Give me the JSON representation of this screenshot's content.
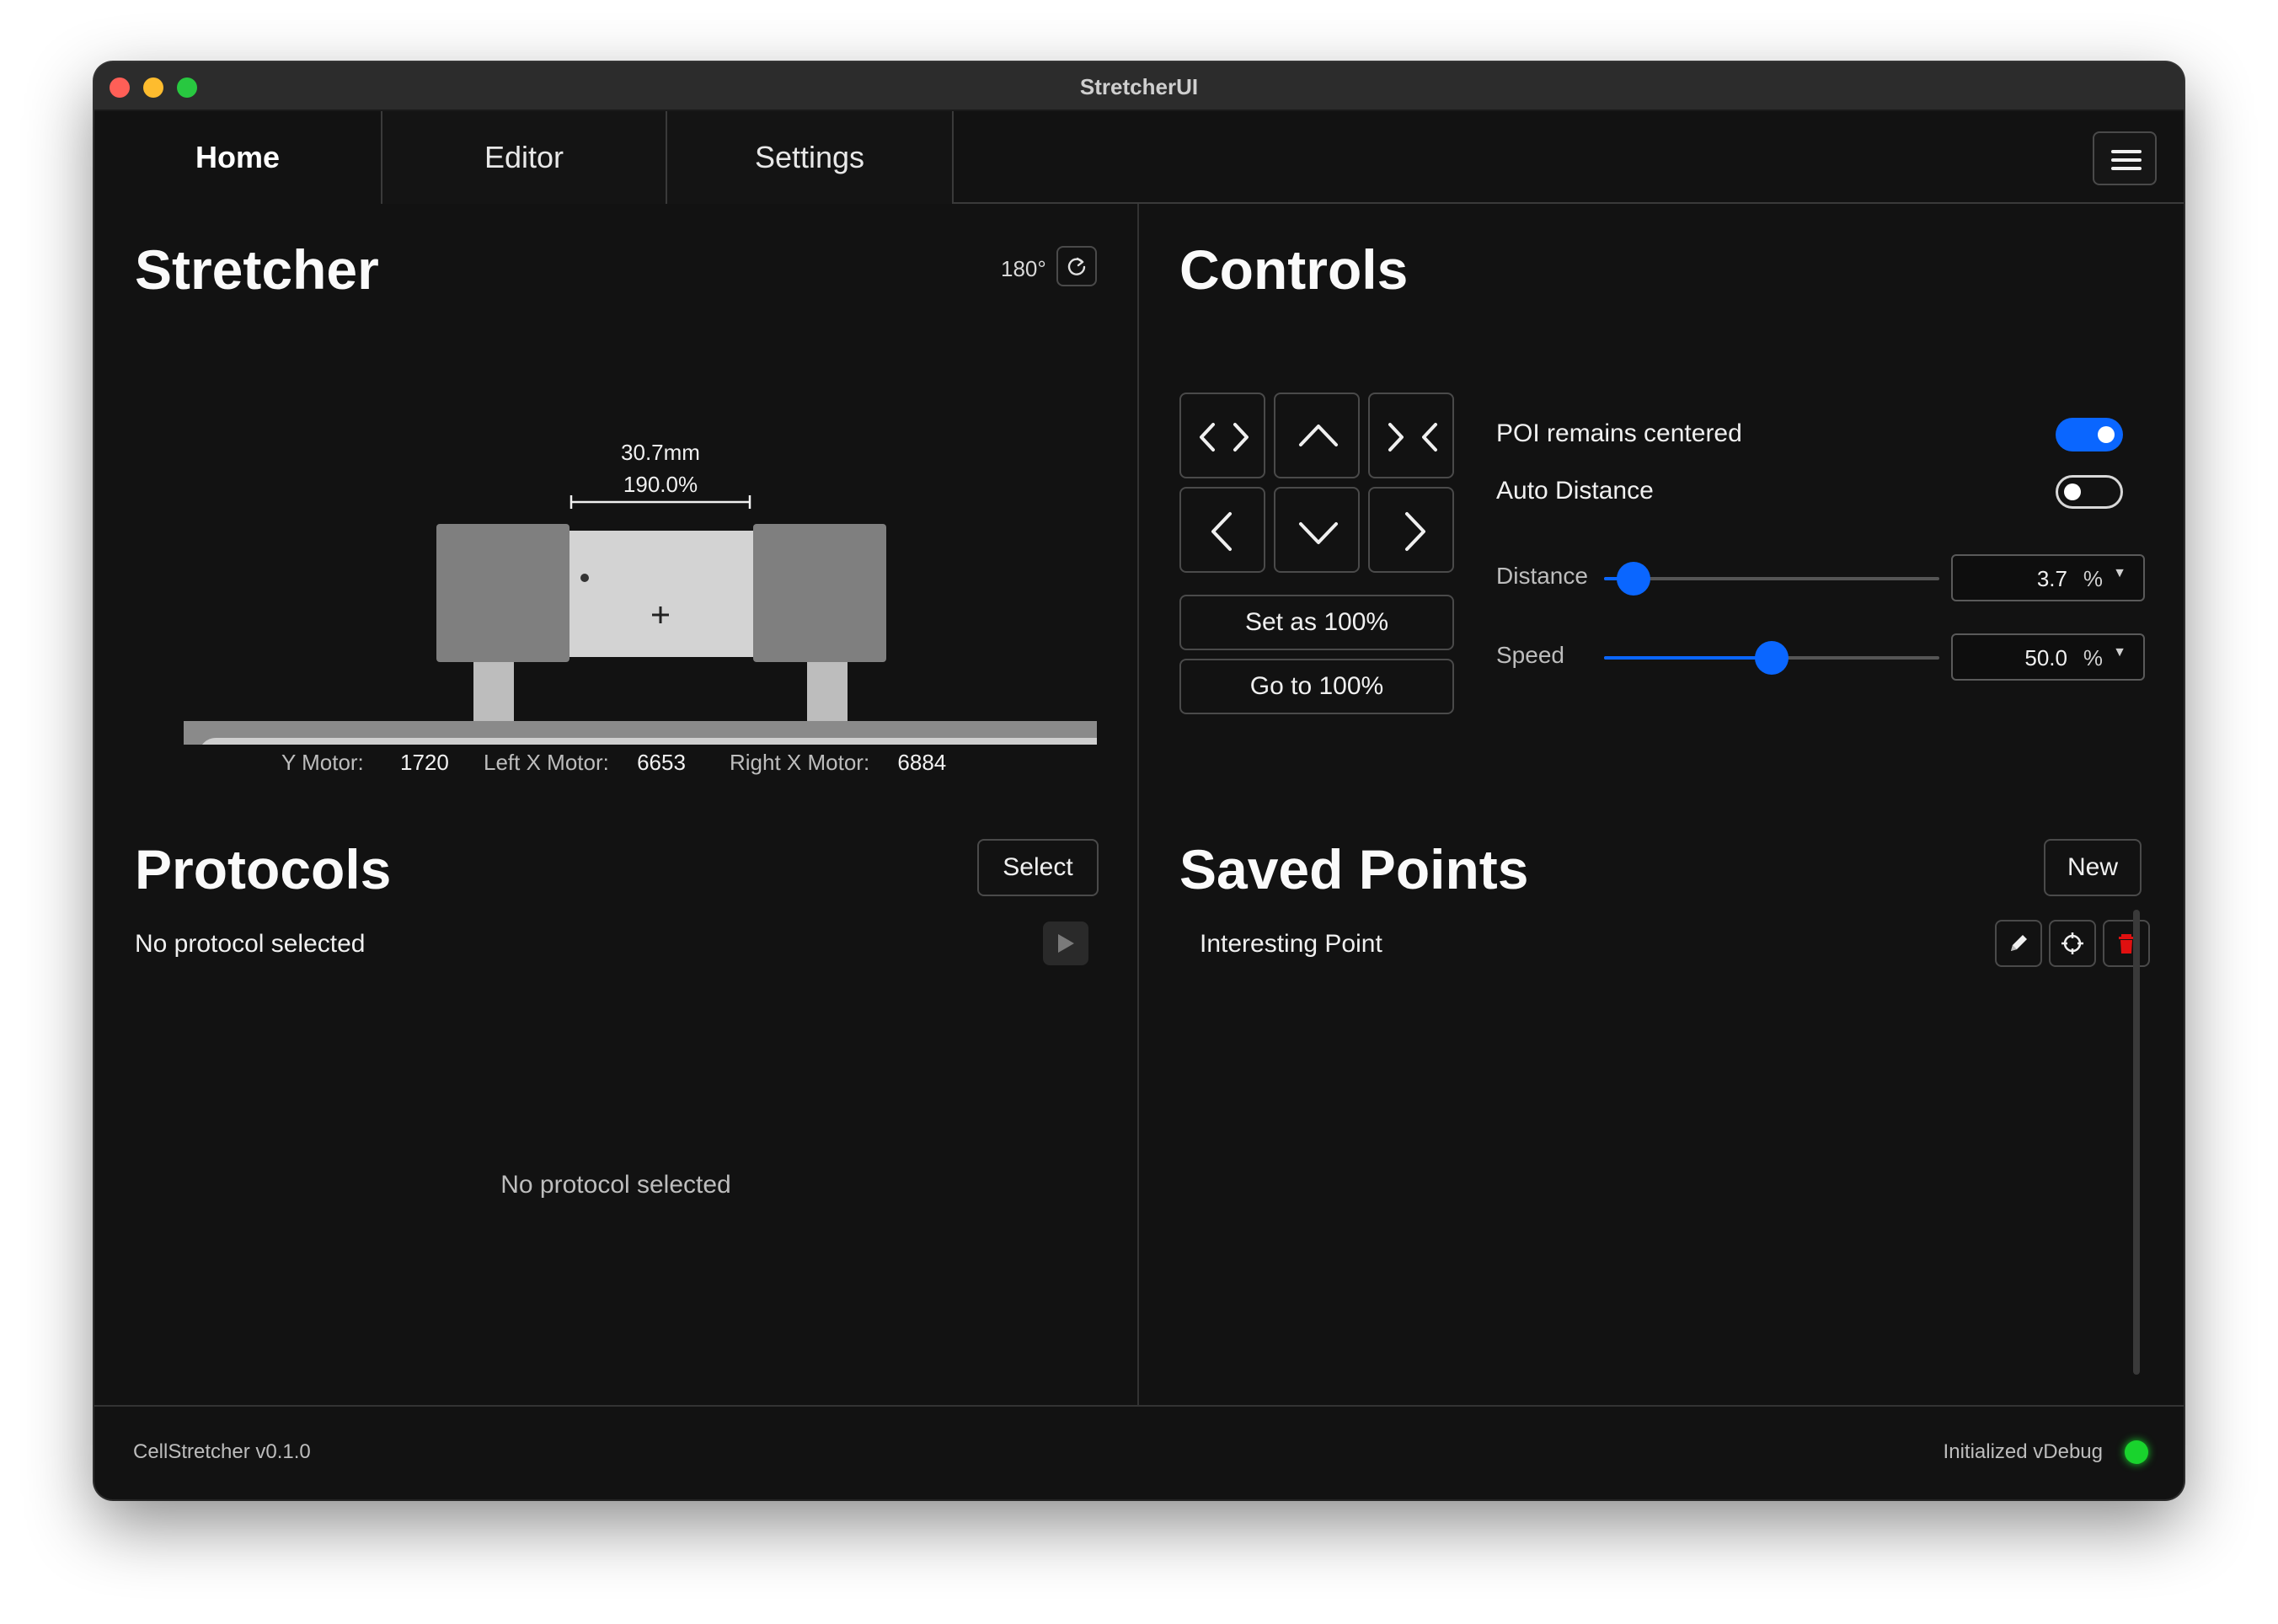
{
  "window": {
    "title": "StretcherUI"
  },
  "tabs": [
    {
      "label": "Home",
      "active": true
    },
    {
      "label": "Editor",
      "active": false
    },
    {
      "label": "Settings",
      "active": false
    }
  ],
  "menu": {
    "icon": "hamburger-icon"
  },
  "stretcher": {
    "title": "Stretcher",
    "rotation_label": "180°",
    "rotate_icon": "rotate-icon",
    "measure_mm": "30.7mm",
    "measure_pct": "190.0%",
    "motors": [
      {
        "label": "Y Motor:",
        "value": "1720"
      },
      {
        "label": "Left X Motor:",
        "value": "6653"
      },
      {
        "label": "Right X Motor:",
        "value": "6884"
      }
    ]
  },
  "controls": {
    "title": "Controls",
    "jog_icons": [
      "expand-icon",
      "up-icon",
      "contract-icon",
      "left-icon",
      "down-icon",
      "right-icon"
    ],
    "set_label": "Set as 100%",
    "goto_label": "Go to 100%",
    "poi_label": "POI remains centered",
    "poi_on": true,
    "auto_label": "Auto Distance",
    "auto_on": false,
    "distance_label": "Distance",
    "distance_value": "3.7",
    "distance_fraction": 0.087,
    "speed_label": "Speed",
    "speed_value": "50.0",
    "speed_fraction": 0.5,
    "unit": "%"
  },
  "protocols": {
    "title": "Protocols",
    "select_label": "Select",
    "current": "No protocol selected",
    "empty_message": "No protocol selected",
    "play_icon": "play-icon"
  },
  "saved_points": {
    "title": "Saved Points",
    "new_label": "New",
    "items": [
      {
        "name": "Interesting Point"
      }
    ],
    "item_icons": [
      "edit-icon",
      "crosshair-icon",
      "trash-icon"
    ]
  },
  "footer": {
    "version": "CellStretcher v0.1.0",
    "status": "Initialized vDebug",
    "status_color": "#19d32d"
  },
  "colors": {
    "accent": "#0a66ff",
    "danger": "#e01010",
    "background": "#121212"
  }
}
